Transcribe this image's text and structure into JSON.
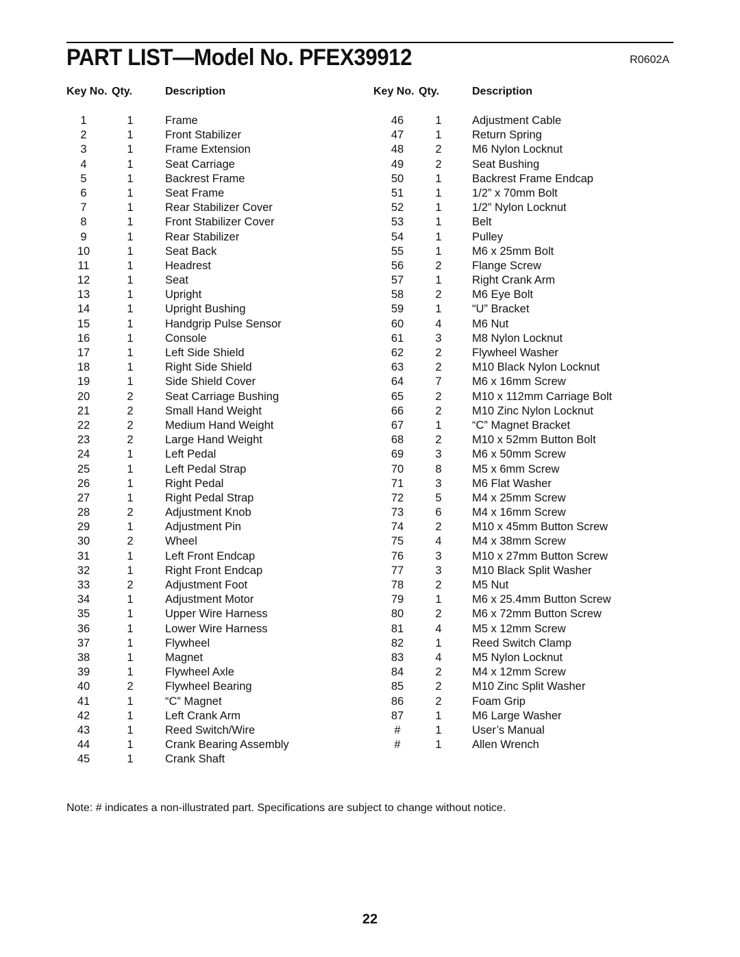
{
  "header": {
    "title": "PART LIST—Model No. PFEX39912",
    "revision_code": "R0602A"
  },
  "columns": {
    "key_label": "Key No.",
    "qty_label": "Qty.",
    "desc_label": "Description"
  },
  "parts_left": [
    {
      "key": "1",
      "qty": "1",
      "desc": "Frame"
    },
    {
      "key": "2",
      "qty": "1",
      "desc": "Front Stabilizer"
    },
    {
      "key": "3",
      "qty": "1",
      "desc": "Frame Extension"
    },
    {
      "key": "4",
      "qty": "1",
      "desc": "Seat Carriage"
    },
    {
      "key": "5",
      "qty": "1",
      "desc": "Backrest Frame"
    },
    {
      "key": "6",
      "qty": "1",
      "desc": "Seat Frame"
    },
    {
      "key": "7",
      "qty": "1",
      "desc": "Rear Stabilizer Cover"
    },
    {
      "key": "8",
      "qty": "1",
      "desc": "Front Stabilizer Cover"
    },
    {
      "key": "9",
      "qty": "1",
      "desc": "Rear Stabilizer"
    },
    {
      "key": "10",
      "qty": "1",
      "desc": "Seat Back"
    },
    {
      "key": "11",
      "qty": "1",
      "desc": "Headrest"
    },
    {
      "key": "12",
      "qty": "1",
      "desc": "Seat"
    },
    {
      "key": "13",
      "qty": "1",
      "desc": "Upright"
    },
    {
      "key": "14",
      "qty": "1",
      "desc": "Upright Bushing"
    },
    {
      "key": "15",
      "qty": "1",
      "desc": "Handgrip Pulse Sensor"
    },
    {
      "key": "16",
      "qty": "1",
      "desc": "Console"
    },
    {
      "key": "17",
      "qty": "1",
      "desc": "Left Side Shield"
    },
    {
      "key": "18",
      "qty": "1",
      "desc": "Right Side Shield"
    },
    {
      "key": "19",
      "qty": "1",
      "desc": "Side Shield Cover"
    },
    {
      "key": "20",
      "qty": "2",
      "desc": "Seat Carriage Bushing"
    },
    {
      "key": "21",
      "qty": "2",
      "desc": "Small Hand Weight"
    },
    {
      "key": "22",
      "qty": "2",
      "desc": "Medium Hand Weight"
    },
    {
      "key": "23",
      "qty": "2",
      "desc": "Large Hand Weight"
    },
    {
      "key": "24",
      "qty": "1",
      "desc": "Left Pedal"
    },
    {
      "key": "25",
      "qty": "1",
      "desc": "Left Pedal Strap"
    },
    {
      "key": "26",
      "qty": "1",
      "desc": "Right Pedal"
    },
    {
      "key": "27",
      "qty": "1",
      "desc": "Right Pedal Strap"
    },
    {
      "key": "28",
      "qty": "2",
      "desc": "Adjustment Knob"
    },
    {
      "key": "29",
      "qty": "1",
      "desc": "Adjustment Pin"
    },
    {
      "key": "30",
      "qty": "2",
      "desc": "Wheel"
    },
    {
      "key": "31",
      "qty": "1",
      "desc": "Left Front Endcap"
    },
    {
      "key": "32",
      "qty": "1",
      "desc": "Right Front Endcap"
    },
    {
      "key": "33",
      "qty": "2",
      "desc": "Adjustment Foot"
    },
    {
      "key": "34",
      "qty": "1",
      "desc": "Adjustment Motor"
    },
    {
      "key": "35",
      "qty": "1",
      "desc": "Upper Wire Harness"
    },
    {
      "key": "36",
      "qty": "1",
      "desc": "Lower Wire Harness"
    },
    {
      "key": "37",
      "qty": "1",
      "desc": "Flywheel"
    },
    {
      "key": "38",
      "qty": "1",
      "desc": "Magnet"
    },
    {
      "key": "39",
      "qty": "1",
      "desc": "Flywheel Axle"
    },
    {
      "key": "40",
      "qty": "2",
      "desc": "Flywheel Bearing"
    },
    {
      "key": "41",
      "qty": "1",
      "desc": "“C” Magnet"
    },
    {
      "key": "42",
      "qty": "1",
      "desc": "Left Crank Arm"
    },
    {
      "key": "43",
      "qty": "1",
      "desc": "Reed Switch/Wire"
    },
    {
      "key": "44",
      "qty": "1",
      "desc": "Crank Bearing Assembly"
    },
    {
      "key": "45",
      "qty": "1",
      "desc": "Crank Shaft"
    }
  ],
  "parts_right": [
    {
      "key": "46",
      "qty": "1",
      "desc": "Adjustment Cable"
    },
    {
      "key": "47",
      "qty": "1",
      "desc": "Return Spring"
    },
    {
      "key": "48",
      "qty": "2",
      "desc": "M6 Nylon Locknut"
    },
    {
      "key": "49",
      "qty": "2",
      "desc": "Seat Bushing"
    },
    {
      "key": "50",
      "qty": "1",
      "desc": "Backrest Frame Endcap"
    },
    {
      "key": "51",
      "qty": "1",
      "desc": "1/2” x 70mm Bolt"
    },
    {
      "key": "52",
      "qty": "1",
      "desc": "1/2” Nylon Locknut"
    },
    {
      "key": "53",
      "qty": "1",
      "desc": "Belt"
    },
    {
      "key": "54",
      "qty": "1",
      "desc": "Pulley"
    },
    {
      "key": "55",
      "qty": "1",
      "desc": "M6 x 25mm Bolt"
    },
    {
      "key": "56",
      "qty": "2",
      "desc": "Flange Screw"
    },
    {
      "key": "57",
      "qty": "1",
      "desc": "Right Crank Arm"
    },
    {
      "key": "58",
      "qty": "2",
      "desc": "M6 Eye Bolt"
    },
    {
      "key": "59",
      "qty": "1",
      "desc": "“U” Bracket"
    },
    {
      "key": "60",
      "qty": "4",
      "desc": "M6 Nut"
    },
    {
      "key": "61",
      "qty": "3",
      "desc": "M8 Nylon Locknut"
    },
    {
      "key": "62",
      "qty": "2",
      "desc": "Flywheel Washer"
    },
    {
      "key": "63",
      "qty": "2",
      "desc": "M10 Black Nylon Locknut"
    },
    {
      "key": "64",
      "qty": "7",
      "desc": "M6 x 16mm Screw"
    },
    {
      "key": "65",
      "qty": "2",
      "desc": "M10 x 112mm Carriage Bolt"
    },
    {
      "key": "66",
      "qty": "2",
      "desc": "M10 Zinc Nylon Locknut"
    },
    {
      "key": "67",
      "qty": "1",
      "desc": "“C” Magnet Bracket"
    },
    {
      "key": "68",
      "qty": "2",
      "desc": "M10 x 52mm Button Bolt"
    },
    {
      "key": "69",
      "qty": "3",
      "desc": "M6 x 50mm Screw"
    },
    {
      "key": "70",
      "qty": "8",
      "desc": "M5 x 6mm Screw"
    },
    {
      "key": "71",
      "qty": "3",
      "desc": "M6 Flat Washer"
    },
    {
      "key": "72",
      "qty": "5",
      "desc": "M4 x 25mm Screw"
    },
    {
      "key": "73",
      "qty": "6",
      "desc": "M4 x 16mm Screw"
    },
    {
      "key": "74",
      "qty": "2",
      "desc": "M10 x 45mm Button Screw"
    },
    {
      "key": "75",
      "qty": "4",
      "desc": "M4 x 38mm Screw"
    },
    {
      "key": "76",
      "qty": "3",
      "desc": "M10 x 27mm Button Screw"
    },
    {
      "key": "77",
      "qty": "3",
      "desc": "M10 Black Split Washer"
    },
    {
      "key": "78",
      "qty": "2",
      "desc": "M5 Nut"
    },
    {
      "key": "79",
      "qty": "1",
      "desc": "M6 x 25.4mm Button Screw"
    },
    {
      "key": "80",
      "qty": "2",
      "desc": "M6 x 72mm Button Screw"
    },
    {
      "key": "81",
      "qty": "4",
      "desc": "M5 x 12mm Screw"
    },
    {
      "key": "82",
      "qty": "1",
      "desc": "Reed Switch Clamp"
    },
    {
      "key": "83",
      "qty": "4",
      "desc": "M5 Nylon Locknut"
    },
    {
      "key": "84",
      "qty": "2",
      "desc": "M4 x 12mm Screw"
    },
    {
      "key": "85",
      "qty": "2",
      "desc": "M10 Zinc Split Washer"
    },
    {
      "key": "86",
      "qty": "2",
      "desc": "Foam Grip"
    },
    {
      "key": "87",
      "qty": "1",
      "desc": "M6 Large Washer"
    },
    {
      "key": "#",
      "qty": "1",
      "desc": "User’s Manual"
    },
    {
      "key": "#",
      "qty": "1",
      "desc": "Allen Wrench"
    }
  ],
  "footer": {
    "note": "Note: # indicates a non-illustrated part. Specifications are subject to change without notice.",
    "page_number": "22"
  }
}
